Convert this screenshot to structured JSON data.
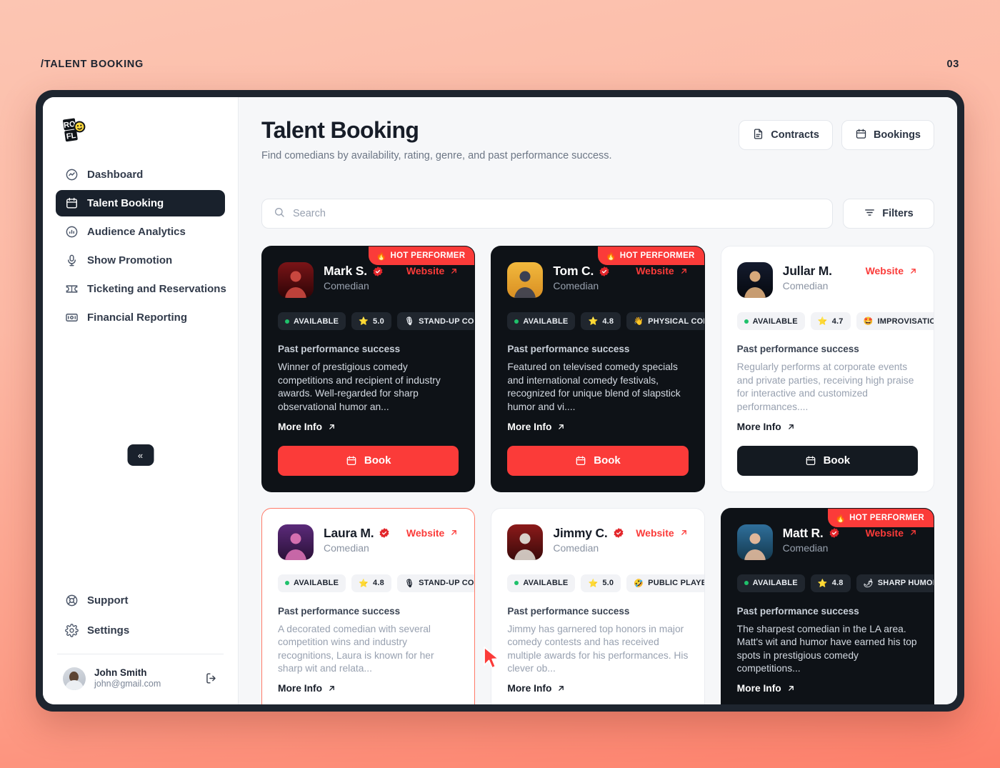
{
  "page_meta": {
    "breadcrumb": "/TALENT BOOKING",
    "page_number": "03"
  },
  "brand": {
    "logo_text": "ROFL"
  },
  "sidebar": {
    "items": [
      {
        "label": "Dashboard",
        "icon": "activity-circle-icon",
        "active": false
      },
      {
        "label": "Talent Booking",
        "icon": "calendar-icon",
        "active": true
      },
      {
        "label": "Audience Analytics",
        "icon": "chart-circle-icon",
        "active": false
      },
      {
        "label": "Show Promotion",
        "icon": "microphone-icon",
        "active": false
      },
      {
        "label": "Ticketing and Reservations",
        "icon": "ticket-icon",
        "active": false
      },
      {
        "label": "Financial Reporting",
        "icon": "money-icon",
        "active": false
      }
    ],
    "bottom_items": [
      {
        "label": "Support",
        "icon": "lifebuoy-icon"
      },
      {
        "label": "Settings",
        "icon": "gear-icon"
      }
    ],
    "collapse_label": "«",
    "user": {
      "name": "John Smith",
      "email": "john@gmail.com",
      "logout_icon": "logout-icon"
    }
  },
  "header": {
    "title": "Talent Booking",
    "subtitle": "Find comedians by availability, rating, genre, and past performance success.",
    "actions": [
      {
        "label": "Contracts",
        "icon": "document-icon"
      },
      {
        "label": "Bookings",
        "icon": "calendar-icon"
      }
    ]
  },
  "search": {
    "placeholder": "Search",
    "value": "",
    "icon": "search-icon"
  },
  "filters": {
    "label": "Filters",
    "icon": "filter-icon"
  },
  "labels": {
    "hot_performer": "HOT PERFORMER",
    "website": "Website",
    "more_info": "More Info",
    "past_performance": "Past performance success",
    "book": "Book"
  },
  "colors": {
    "accent_red": "#fb3b39",
    "dark_card": "#0e1217",
    "available_green": "#1fc16b",
    "selected_border": "#ff7a68",
    "bg_gradient_from": "#fcc5b2",
    "bg_gradient_to": "#fd7f6a"
  },
  "cards": [
    {
      "name": "Mark S.",
      "role": "Comedian",
      "verified": true,
      "hot": true,
      "theme": "dark",
      "selected": false,
      "availability": "AVAILABLE",
      "rating": "5.0",
      "genre": "STAND-UP COMEDY",
      "genre_emoji": "🎙",
      "description": "Winner of prestigious comedy competitions and recipient of industry awards. Well-regarded for sharp observational humor an...",
      "book_style": "red"
    },
    {
      "name": "Tom C.",
      "role": "Comedian",
      "verified": true,
      "hot": true,
      "theme": "dark",
      "selected": false,
      "availability": "AVAILABLE",
      "rating": "4.8",
      "genre": "PHYSICAL COMEDY",
      "genre_emoji": "👋",
      "description": "Featured on televised comedy specials and international comedy festivals, recognized for unique blend of slapstick humor and vi....",
      "book_style": "red"
    },
    {
      "name": "Jullar M.",
      "role": "Comedian",
      "verified": false,
      "hot": false,
      "theme": "light",
      "selected": false,
      "availability": "AVAILABLE",
      "rating": "4.7",
      "genre": "IMPROVISATION",
      "genre_emoji": "🤩",
      "description": "Regularly performs at corporate events and private parties, receiving high praise for interactive and customized performances....",
      "book_style": "dark"
    },
    {
      "name": "Laura M.",
      "role": "Comedian",
      "verified": true,
      "hot": false,
      "theme": "light",
      "selected": true,
      "availability": "AVAILABLE",
      "rating": "4.8",
      "genre": "STAND-UP COMEDY",
      "genre_emoji": "🎙",
      "description": "A decorated comedian with several competition wins and industry recognitions, Laura is known for her sharp wit and relata...",
      "book_style": "dark"
    },
    {
      "name": "Jimmy C.",
      "role": "Comedian",
      "verified": true,
      "hot": false,
      "theme": "light",
      "selected": false,
      "availability": "AVAILABLE",
      "rating": "5.0",
      "genre": "PUBLIC PLAYER",
      "genre_emoji": "🤣",
      "description": "Jimmy has garnered top honors in major comedy contests and has received multiple awards for his performances. His clever ob...",
      "book_style": "dark"
    },
    {
      "name": "Matt R.",
      "role": "Comedian",
      "verified": true,
      "hot": true,
      "theme": "dark",
      "selected": false,
      "availability": "AVAILABLE",
      "rating": "4.8",
      "genre": "SHARP HUMOR",
      "genre_emoji": "🌶",
      "description": "The sharpest comedian in the LA area. Matt's wit and humor have earned his top spots in prestigious comedy competitions...",
      "book_style": "red"
    }
  ]
}
